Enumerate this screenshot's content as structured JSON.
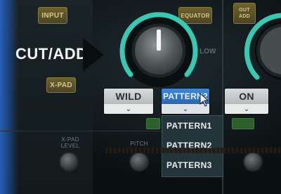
{
  "left_panel": {
    "input_button": "INPUT",
    "xpad_button": "X-PAD",
    "section_title": "CUT/ADD",
    "xpad_level_label": "X-PAD\nLEVEL"
  },
  "top_bar": {
    "equator_button": "EQUATOR",
    "right_top_button": "OUT\nADD"
  },
  "knob": {
    "low_label": "LOW",
    "pitch_label": "PITCH"
  },
  "selectors": {
    "wild": {
      "label": "WILD",
      "arrow": "⌄"
    },
    "pattern": {
      "label": "PATTERN2",
      "arrow": "⌄"
    },
    "on": {
      "label": "ON",
      "arrow": "⌄"
    }
  },
  "pattern_dropdown": {
    "options": [
      "PATTERN1",
      "PATTERN2",
      "PATTERN3"
    ],
    "selected": "PATTERN2"
  },
  "colors": {
    "accent_teal": "#37c9b4",
    "selector_blue": "#2f74c2"
  }
}
